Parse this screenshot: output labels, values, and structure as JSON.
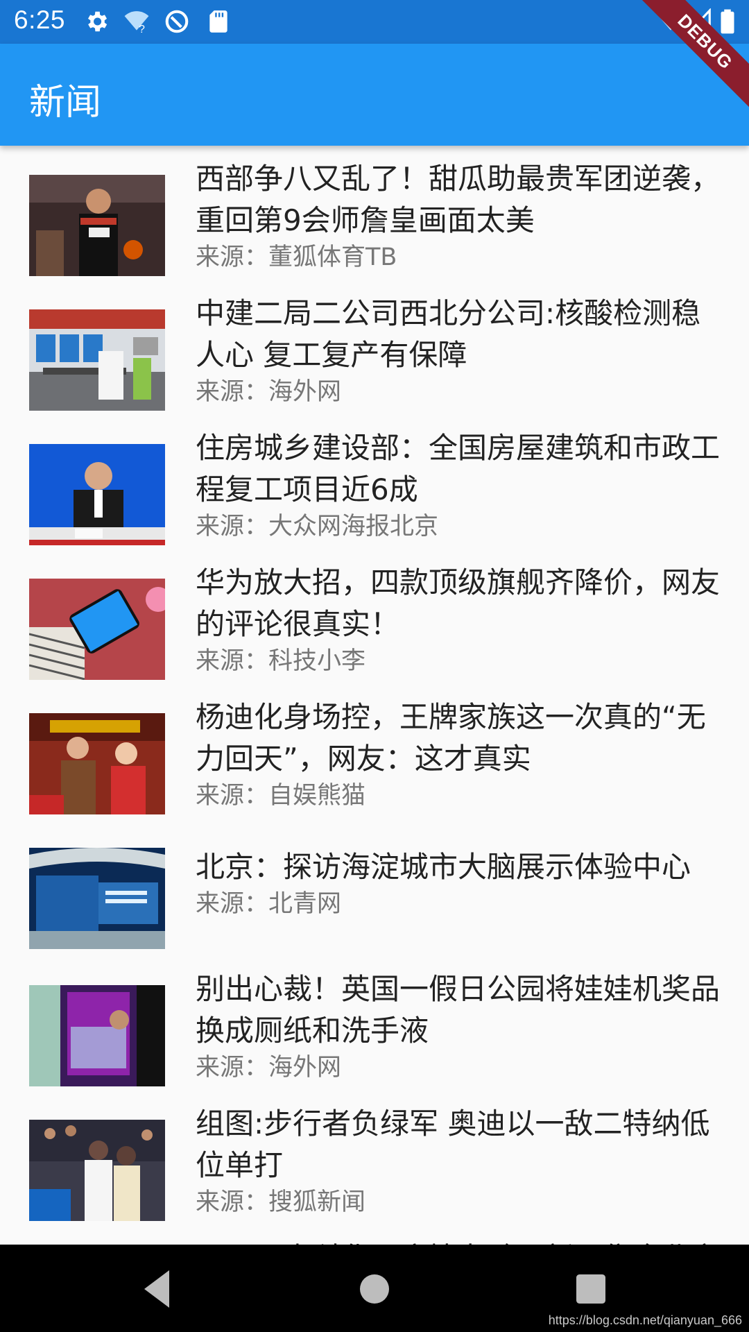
{
  "status_bar": {
    "time": "6:25",
    "left_icons": [
      "gear-icon",
      "wifi-question-icon",
      "circle-slash-icon",
      "sd-card-icon"
    ],
    "right_icons": [
      "wifi-off-icon",
      "signal-icon",
      "battery-icon"
    ]
  },
  "debug_banner": "DEBUG",
  "app_bar": {
    "title": "新闻",
    "background": "#2196f3"
  },
  "news": [
    {
      "title": "西部争八又乱了！甜瓜助最贵军团逆袭，重回第9会师詹皇画面太美",
      "source": "来源：董狐体育TB"
    },
    {
      "title": "中建二局二公司西北分公司:核酸检测稳人心 复工复产有保障",
      "source": "来源：海外网"
    },
    {
      "title": "住房城乡建设部：全国房屋建筑和市政工程复工项目近6成",
      "source": "来源：大众网海报北京"
    },
    {
      "title": "华为放大招，四款顶级旗舰齐降价，网友的评论很真实！",
      "source": "来源：科技小李"
    },
    {
      "title": "杨迪化身场控，王牌家族这一次真的“无力回天”，网友：这才真实",
      "source": "来源：自娱熊猫"
    },
    {
      "title": "北京：探访海淀城市大脑展示体验中心",
      "source": "来源：北青网"
    },
    {
      "title": "别出心裁！英国一假日公园将娃娃机奖品换成厕纸和洗手液",
      "source": "来源：海外网"
    },
    {
      "title": "组图:步行者负绿军 奥迪以一敌二特纳低位单打",
      "source": "来源：搜狐新闻"
    },
    {
      "title": "阿里云光科华：广情老验，新零售全北京",
      "source": ""
    }
  ],
  "nav_bar": {
    "buttons": [
      "back-icon",
      "home-icon",
      "recents-icon"
    ]
  },
  "watermark": "https://blog.csdn.net/qianyuan_666"
}
